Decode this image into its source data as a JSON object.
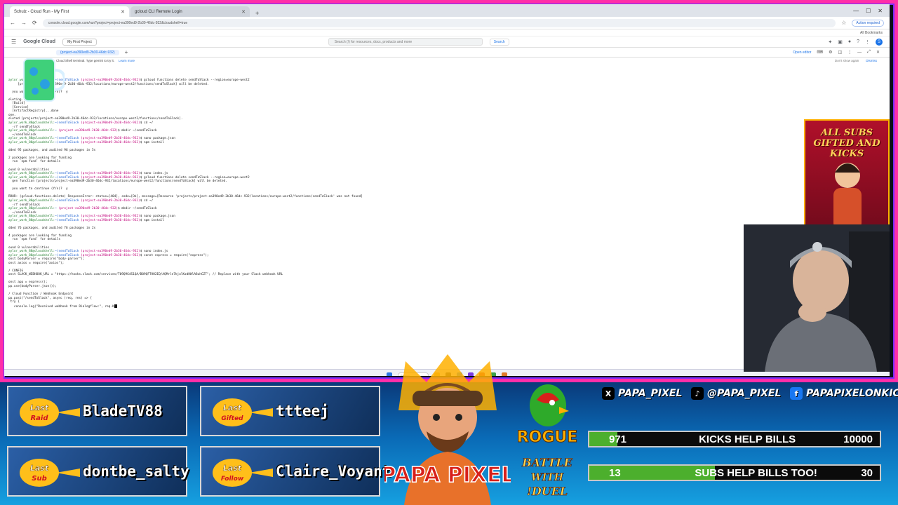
{
  "browser": {
    "tabs": [
      {
        "title": "Schulz - Cloud Run - My First",
        "active": true
      },
      {
        "title": "gcloud CLI Remote Login",
        "active": false
      }
    ],
    "new_tab": "+",
    "window_controls": [
      "—",
      "☐",
      "✕"
    ],
    "url": "console.cloud.google.com/run?project=project-ea390ed9-2b30-46dc-932&cloudshell=true",
    "relaunch": "Action required",
    "bookmarks": "All Bookmarks"
  },
  "gcp": {
    "logo": "Google Cloud",
    "project": "My First Project",
    "search_placeholder": "Search (/) for resources, docs, products and more",
    "search_button": "Search",
    "avatar": "S"
  },
  "shell": {
    "tab": "(project-ea390ed9-2b30-46dc-932)",
    "open_editor": "Open editor",
    "info": "Cloud Shell terminal. Type gemini to try it.",
    "info_link": "Learn more",
    "dont_show": "Don't show again",
    "dismiss": "Dismiss"
  },
  "terminal": {
    "lines": [
      {
        "u": "aylor_work_88@cloudshell:",
        "d": "~/sendToSlack",
        "p": " (project-ea390ed9-2b30-46dc-932)",
        "t": "$ gcloud functions delete sendToSlack --region=europe-west2"
      },
      {
        "t": "     [projects/project-ea390ed9-2b30-46dc-932/locations/europe-west2/functions/sendToSlack] will be deleted."
      },
      {
        "t": ""
      },
      {
        "t": "  you want to continue (Y/n)?  y"
      },
      {
        "t": ""
      },
      {
        "t": "eleting..."
      },
      {
        "t": "  [Build]"
      },
      {
        "t": "  [Service]"
      },
      {
        "t": "  [ArtifactRegistry]...done"
      },
      {
        "t": "one."
      },
      {
        "t": "eleted [projects/project-ea390ed9-2b30-46dc-932/locations/europe-west2/functions/sendToSlack]."
      },
      {
        "u": "aylor_work_88@cloudshell:",
        "d": "~/sendToSlack",
        "p": " (project-ea390ed9-2b30-46dc-932)",
        "t": "$ cd ~/"
      },
      {
        "t": "  -rf sendToSlack"
      },
      {
        "u": "aylor_work_88@cloudshell:",
        "d": "~",
        "p": " (project-ea390ed9-2b30-46dc-932)",
        "t": "$ mkdir ~/sendToSlack"
      },
      {
        "t": "  ~/sendToSlack"
      },
      {
        "u": "aylor_work_88@cloudshell:",
        "d": "~/sendToSlack",
        "p": " (project-ea390ed9-2b30-46dc-932)",
        "t": "$ nano package.json"
      },
      {
        "u": "aylor_work_88@cloudshell:",
        "d": "~/sendToSlack",
        "p": " (project-ea390ed9-2b30-46dc-932)",
        "t": "$ npm install"
      },
      {
        "t": ""
      },
      {
        "t": "dded 95 packages, and audited 96 packages in 5s"
      },
      {
        "t": ""
      },
      {
        "t": "2 packages are looking for funding"
      },
      {
        "t": "  run `npm fund` for details"
      },
      {
        "t": ""
      },
      {
        "t": "ound 0 vulnerabilities"
      },
      {
        "u": "aylor_work_88@cloudshell:",
        "d": "~/sendToSlack",
        "p": " (project-ea390ed9-2b30-46dc-932)",
        "t": "$ nano index.js"
      },
      {
        "u": "aylor_work_88@cloudshell:",
        "d": "~/sendToSlack",
        "p": " (project-ea390ed9-2b30-46dc-932)",
        "t": "$ gcloud functions delete sendToSlack --region=europe-west2"
      },
      {
        "t": "  gen function [projects/project-ea390ed9-2b30-46dc-932/locations/europe-west2/functions/sendToSlack] will be deleted."
      },
      {
        "t": ""
      },
      {
        "t": "  you want to continue (Y/n)?  y"
      },
      {
        "t": ""
      },
      {
        "t": "RROR: (gcloud.functions.delete) ResponseError: status=[404], code=[Ok], message=[Resource 'projects/project-ea390ed9-2b30-46dc-932/locations/europe-west2/functions/sendToSlack' was not found]"
      },
      {
        "u": "aylor_work_88@cloudshell:",
        "d": "~/sendToSlack",
        "p": " (project-ea390ed9-2b30-46dc-932)",
        "t": "$ cd ~/"
      },
      {
        "t": "  -rf sendToSlack"
      },
      {
        "u": "aylor_work_88@cloudshell:",
        "d": "~",
        "p": " (project-ea390ed9-2b30-46dc-932)",
        "t": "$ mkdir ~/sendToSlack"
      },
      {
        "t": "  ~/sendToSlack"
      },
      {
        "u": "aylor_work_88@cloudshell:",
        "d": "~/sendToSlack",
        "p": " (project-ea390ed9-2b30-46dc-932)",
        "t": "$ nano package.json"
      },
      {
        "u": "aylor_work_88@cloudshell:",
        "d": "~/sendToSlack",
        "p": " (project-ea390ed9-2b30-46dc-932)",
        "t": "$ npm install"
      },
      {
        "t": ""
      },
      {
        "t": "dded 76 packages, and audited 76 packages in 2s"
      },
      {
        "t": ""
      },
      {
        "t": "4 packages are looking for funding"
      },
      {
        "t": "  run `npm fund` for details"
      },
      {
        "t": ""
      },
      {
        "t": "ound 0 vulnerabilities"
      },
      {
        "u": "aylor_work_88@cloudshell:",
        "d": "~/sendToSlack",
        "p": " (project-ea390ed9-2b30-46dc-932)",
        "t": "$ nano index.js"
      },
      {
        "u": "aylor_work_88@cloudshell:",
        "d": "~/sendToSlack",
        "p": " (project-ea390ed9-2b30-46dc-932)",
        "t": "$ const express = require(\"express\");"
      },
      {
        "t": "onst bodyParser = require(\"body-parser\");"
      },
      {
        "t": "onst axios = require(\"axios\");"
      },
      {
        "t": ""
      },
      {
        "t": "/ CONFIG"
      },
      {
        "t": "onst SLACK_WEBHOOK_URL = \"https://hooks.slack.com/services/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\"; // Replace with your Slack webhook URL"
      },
      {
        "t": ""
      },
      {
        "t": "onst app = express();"
      },
      {
        "t": "pp.use(bodyParser.json());"
      },
      {
        "t": ""
      },
      {
        "t": "/ Cloud Function / Webhook Endpoint"
      },
      {
        "t": "pp.post(\"/sendToSlack\", async (req, res) => {"
      },
      {
        "t": " try {"
      },
      {
        "t": "   console.log(\"Received webhook from Dialogflow:\", req.b",
        "cursor": true
      }
    ]
  },
  "overlay": {
    "sub_art": "ALL SUBS GIFTED AND KICKS",
    "last": [
      {
        "label": "LAST RAID",
        "name": "BladeTV88"
      },
      {
        "label": "LAST GIFTED",
        "name": "ttteej"
      },
      {
        "label": "LAST SUB",
        "name": "dontbe_salty"
      },
      {
        "label": "LAST FOLLOW",
        "name": "Claire_Voyant"
      }
    ],
    "logo_text": "PAPA PIXEL",
    "rogue": "ROGUE",
    "battle": [
      "BATTLE",
      "WITH",
      "!DUEL"
    ],
    "socials": [
      {
        "icon": "X",
        "handle": "PAPA_PIXEL"
      },
      {
        "icon": "♪",
        "handle": "@PAPA_PIXEL"
      },
      {
        "icon": "f",
        "handle": "PAPAPIXELONKICK"
      }
    ],
    "goals": [
      {
        "current": "971",
        "label": "KICKS HELP BILLS",
        "target": "10000",
        "progress": 0.0971
      },
      {
        "current": "13",
        "label": "SUBS HELP BILLS TOO!",
        "target": "30",
        "progress": 0.4333
      }
    ],
    "colors": {
      "frame": "#ff2fa8",
      "goal_fill": "#4caf2d",
      "gold": "#ffb200"
    }
  }
}
